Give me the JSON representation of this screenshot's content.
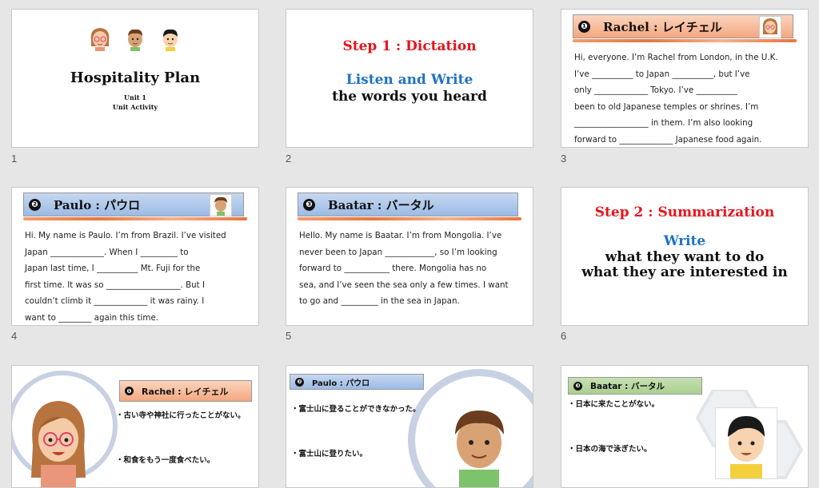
{
  "slides": [
    {
      "number": "1",
      "title": "Hospitality Plan",
      "unit": "Unit 1",
      "activity": "Unit Activity"
    },
    {
      "number": "2",
      "step": "Step 1 : Dictation",
      "line1": "Listen and Write",
      "line2": "the words you heard"
    },
    {
      "number": "3",
      "bullet": "❶",
      "header": "Rachel : レイチェル",
      "lines": [
        "Hi, everyone.  I’m Rachel from London, in the U.K.",
        "I’ve __________ to Japan __________, but I’ve",
        "only _____________ Tokyo.  I’ve __________",
        "been to old Japanese temples or shrines.  I’m",
        "__________________ in them.  I’m also looking",
        "forward to _____________ Japanese food again."
      ]
    },
    {
      "number": "4",
      "bullet": "❷",
      "header": "Paulo : パウロ",
      "lines": [
        "Hi.  My name is Paulo.  I’m from Brazil.  I’ve visited",
        "Japan _____________.  When I _________ to",
        "Japan last time, I __________ Mt. Fuji for the",
        "first time.  It was so __________________.  But I",
        "couldn’t climb it _____________ it was rainy.  I",
        "want to ________ again this time."
      ]
    },
    {
      "number": "5",
      "bullet": "❸",
      "header": "Baatar : バータル",
      "lines": [
        "Hello.  My name is Baatar.  I’m from Mongolia.  I’ve",
        "never been to Japan ____________, so I’m looking",
        "forward to ___________ there.  Mongolia has no",
        "sea, and I’ve seen the sea only a few times.  I want",
        "to go and _________ in the sea in Japan."
      ]
    },
    {
      "number": "6",
      "step": "Step 2 : Summarization",
      "line1": "Write",
      "line2": "what they want to do",
      "line3": "what they are interested in"
    },
    {
      "number": "7",
      "bullet": "❶",
      "header": "Rachel : レイチェル",
      "items": [
        "・古い寺や神社に行ったことがない。",
        "・和食をもう一度食べたい。"
      ]
    },
    {
      "number": "8",
      "bullet": "❷",
      "header": "Paulo : パウロ",
      "items": [
        "・富士山に登ることができなかった。",
        "・富士山に登りたい。"
      ]
    },
    {
      "number": "9",
      "bullet": "❸",
      "header": "Baatar : バータル",
      "items": [
        "・日本に来たことがない。",
        "・日本の海で泳ぎたい。"
      ]
    }
  ],
  "colors": {
    "step_red": "#e8141c",
    "step_blue": "#1f72c4",
    "orange_bar": "#f4a77f",
    "blue_bar": "#9bbbe6",
    "green_bar": "#a9d08e"
  }
}
